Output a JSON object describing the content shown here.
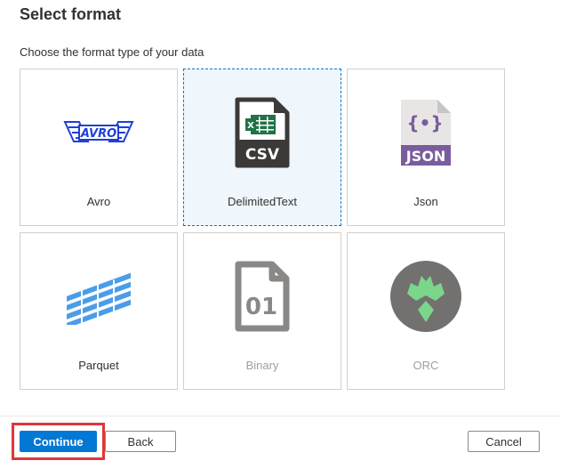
{
  "header": {
    "title": "Select format",
    "subtitle": "Choose the format type of your data"
  },
  "formats": [
    {
      "label": "Avro",
      "icon": "avro-logo-icon",
      "selected": false,
      "enabled": true,
      "logo_text": "AVRO"
    },
    {
      "label": "DelimitedText",
      "icon": "csv-file-icon",
      "selected": true,
      "enabled": true,
      "badge_text": "CSV"
    },
    {
      "label": "Json",
      "icon": "json-file-icon",
      "selected": false,
      "enabled": true,
      "badge_text": "JSON",
      "glyph": "{•}"
    },
    {
      "label": "Parquet",
      "icon": "parquet-logo-icon",
      "selected": false,
      "enabled": true
    },
    {
      "label": "Binary",
      "icon": "binary-file-icon",
      "selected": false,
      "enabled": false,
      "badge_text": "01"
    },
    {
      "label": "ORC",
      "icon": "orc-logo-icon",
      "selected": false,
      "enabled": false
    }
  ],
  "footer": {
    "continue_label": "Continue",
    "back_label": "Back",
    "cancel_label": "Cancel"
  },
  "colors": {
    "accent": "#0078d4",
    "selected_bg": "#eff6fc",
    "highlight": "#e0363b",
    "csv_green": "#217346",
    "json_purple": "#7a5c9e",
    "parquet_blue": "#4a9de8",
    "orc_green": "#7bd68a"
  }
}
